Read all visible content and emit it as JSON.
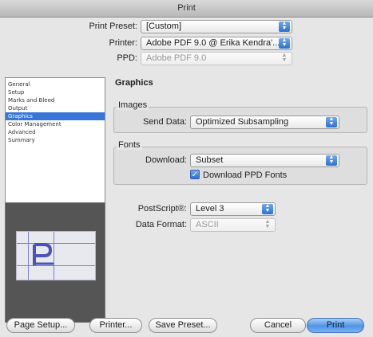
{
  "window": {
    "title": "Print"
  },
  "top": {
    "preset_label": "Print Preset:",
    "preset_value": "[Custom]",
    "printer_label": "Printer:",
    "printer_value": "Adobe PDF 9.0 @ Erika Kendra'...",
    "ppd_label": "PPD:",
    "ppd_value": "Adobe PDF 9.0"
  },
  "sidebar": {
    "items": [
      {
        "label": "General"
      },
      {
        "label": "Setup"
      },
      {
        "label": "Marks and Bleed"
      },
      {
        "label": "Output"
      },
      {
        "label": "Graphics"
      },
      {
        "label": "Color Management"
      },
      {
        "label": "Advanced"
      },
      {
        "label": "Summary"
      }
    ],
    "selected": "Graphics"
  },
  "graphics": {
    "title": "Graphics",
    "images_legend": "Images",
    "send_data_label": "Send Data:",
    "send_data_value": "Optimized Subsampling",
    "fonts_legend": "Fonts",
    "download_label": "Download:",
    "download_value": "Subset",
    "download_ppd_label": "Download PPD Fonts",
    "download_ppd_checked": true,
    "postscript_label": "PostScript®:",
    "postscript_value": "Level 3",
    "data_format_label": "Data Format:",
    "data_format_value": "ASCII"
  },
  "footer": {
    "page_setup": "Page Setup...",
    "printer": "Printer...",
    "save_preset": "Save Preset...",
    "cancel": "Cancel",
    "print": "Print"
  },
  "colors": {
    "accent": "#3875d7",
    "preview_bg": "#555555"
  }
}
